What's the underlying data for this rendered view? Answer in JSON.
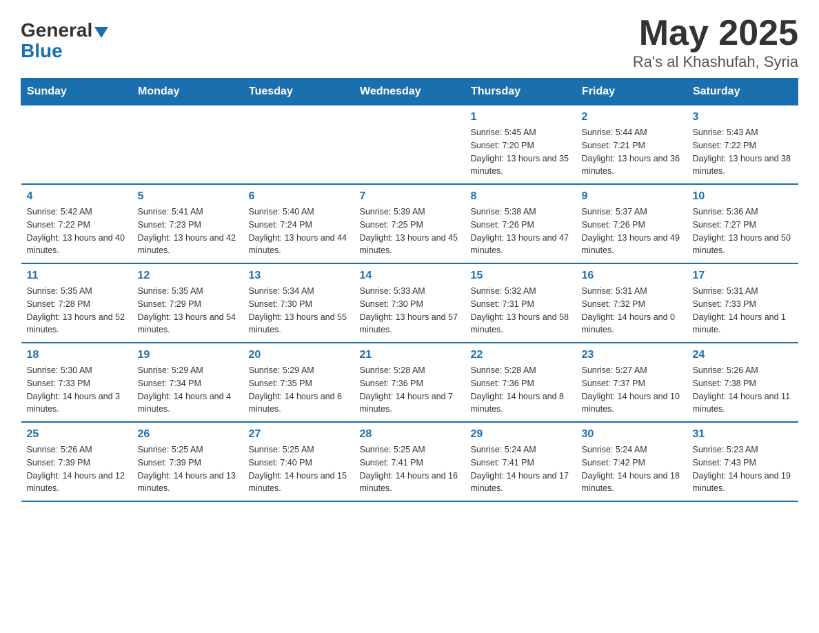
{
  "header": {
    "logo": {
      "general": "General",
      "blue": "Blue",
      "triangle": "▼"
    },
    "month": "May 2025",
    "location": "Ra's al Khashufah, Syria"
  },
  "days_of_week": [
    "Sunday",
    "Monday",
    "Tuesday",
    "Wednesday",
    "Thursday",
    "Friday",
    "Saturday"
  ],
  "weeks": [
    [
      {
        "day": "",
        "info": ""
      },
      {
        "day": "",
        "info": ""
      },
      {
        "day": "",
        "info": ""
      },
      {
        "day": "",
        "info": ""
      },
      {
        "day": "1",
        "info": "Sunrise: 5:45 AM\nSunset: 7:20 PM\nDaylight: 13 hours and 35 minutes."
      },
      {
        "day": "2",
        "info": "Sunrise: 5:44 AM\nSunset: 7:21 PM\nDaylight: 13 hours and 36 minutes."
      },
      {
        "day": "3",
        "info": "Sunrise: 5:43 AM\nSunset: 7:22 PM\nDaylight: 13 hours and 38 minutes."
      }
    ],
    [
      {
        "day": "4",
        "info": "Sunrise: 5:42 AM\nSunset: 7:22 PM\nDaylight: 13 hours and 40 minutes."
      },
      {
        "day": "5",
        "info": "Sunrise: 5:41 AM\nSunset: 7:23 PM\nDaylight: 13 hours and 42 minutes."
      },
      {
        "day": "6",
        "info": "Sunrise: 5:40 AM\nSunset: 7:24 PM\nDaylight: 13 hours and 44 minutes."
      },
      {
        "day": "7",
        "info": "Sunrise: 5:39 AM\nSunset: 7:25 PM\nDaylight: 13 hours and 45 minutes."
      },
      {
        "day": "8",
        "info": "Sunrise: 5:38 AM\nSunset: 7:26 PM\nDaylight: 13 hours and 47 minutes."
      },
      {
        "day": "9",
        "info": "Sunrise: 5:37 AM\nSunset: 7:26 PM\nDaylight: 13 hours and 49 minutes."
      },
      {
        "day": "10",
        "info": "Sunrise: 5:36 AM\nSunset: 7:27 PM\nDaylight: 13 hours and 50 minutes."
      }
    ],
    [
      {
        "day": "11",
        "info": "Sunrise: 5:35 AM\nSunset: 7:28 PM\nDaylight: 13 hours and 52 minutes."
      },
      {
        "day": "12",
        "info": "Sunrise: 5:35 AM\nSunset: 7:29 PM\nDaylight: 13 hours and 54 minutes."
      },
      {
        "day": "13",
        "info": "Sunrise: 5:34 AM\nSunset: 7:30 PM\nDaylight: 13 hours and 55 minutes."
      },
      {
        "day": "14",
        "info": "Sunrise: 5:33 AM\nSunset: 7:30 PM\nDaylight: 13 hours and 57 minutes."
      },
      {
        "day": "15",
        "info": "Sunrise: 5:32 AM\nSunset: 7:31 PM\nDaylight: 13 hours and 58 minutes."
      },
      {
        "day": "16",
        "info": "Sunrise: 5:31 AM\nSunset: 7:32 PM\nDaylight: 14 hours and 0 minutes."
      },
      {
        "day": "17",
        "info": "Sunrise: 5:31 AM\nSunset: 7:33 PM\nDaylight: 14 hours and 1 minute."
      }
    ],
    [
      {
        "day": "18",
        "info": "Sunrise: 5:30 AM\nSunset: 7:33 PM\nDaylight: 14 hours and 3 minutes."
      },
      {
        "day": "19",
        "info": "Sunrise: 5:29 AM\nSunset: 7:34 PM\nDaylight: 14 hours and 4 minutes."
      },
      {
        "day": "20",
        "info": "Sunrise: 5:29 AM\nSunset: 7:35 PM\nDaylight: 14 hours and 6 minutes."
      },
      {
        "day": "21",
        "info": "Sunrise: 5:28 AM\nSunset: 7:36 PM\nDaylight: 14 hours and 7 minutes."
      },
      {
        "day": "22",
        "info": "Sunrise: 5:28 AM\nSunset: 7:36 PM\nDaylight: 14 hours and 8 minutes."
      },
      {
        "day": "23",
        "info": "Sunrise: 5:27 AM\nSunset: 7:37 PM\nDaylight: 14 hours and 10 minutes."
      },
      {
        "day": "24",
        "info": "Sunrise: 5:26 AM\nSunset: 7:38 PM\nDaylight: 14 hours and 11 minutes."
      }
    ],
    [
      {
        "day": "25",
        "info": "Sunrise: 5:26 AM\nSunset: 7:39 PM\nDaylight: 14 hours and 12 minutes."
      },
      {
        "day": "26",
        "info": "Sunrise: 5:25 AM\nSunset: 7:39 PM\nDaylight: 14 hours and 13 minutes."
      },
      {
        "day": "27",
        "info": "Sunrise: 5:25 AM\nSunset: 7:40 PM\nDaylight: 14 hours and 15 minutes."
      },
      {
        "day": "28",
        "info": "Sunrise: 5:25 AM\nSunset: 7:41 PM\nDaylight: 14 hours and 16 minutes."
      },
      {
        "day": "29",
        "info": "Sunrise: 5:24 AM\nSunset: 7:41 PM\nDaylight: 14 hours and 17 minutes."
      },
      {
        "day": "30",
        "info": "Sunrise: 5:24 AM\nSunset: 7:42 PM\nDaylight: 14 hours and 18 minutes."
      },
      {
        "day": "31",
        "info": "Sunrise: 5:23 AM\nSunset: 7:43 PM\nDaylight: 14 hours and 19 minutes."
      }
    ]
  ]
}
